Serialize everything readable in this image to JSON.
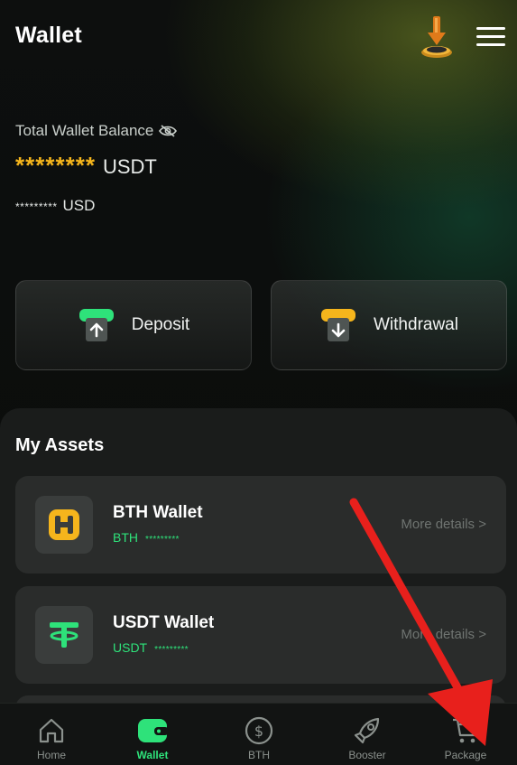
{
  "header": {
    "title": "Wallet",
    "download_icon": "download-icon",
    "menu_icon": "hamburger-menu-icon"
  },
  "balance": {
    "label": "Total Wallet Balance",
    "visibility_icon": "eye-slash-icon",
    "usdt_masked": "********",
    "usdt_unit": "USDT",
    "usd_masked": "*********",
    "usd_unit": "USD"
  },
  "actions": {
    "deposit_label": "Deposit",
    "withdrawal_label": "Withdrawal"
  },
  "assets": {
    "title": "My Assets",
    "items": [
      {
        "name": "BTH Wallet",
        "symbol": "BTH",
        "masked": "*********",
        "more": "More details >",
        "icon": "bth-logo-icon"
      },
      {
        "name": "USDT Wallet",
        "symbol": "USDT",
        "masked": "*********",
        "more": "More details >",
        "icon": "tether-logo-icon"
      }
    ]
  },
  "nav": {
    "items": [
      {
        "label": "Home",
        "icon": "home-icon"
      },
      {
        "label": "Wallet",
        "icon": "wallet-icon"
      },
      {
        "label": "BTH",
        "icon": "dollar-coin-icon"
      },
      {
        "label": "Booster",
        "icon": "rocket-icon"
      },
      {
        "label": "Package",
        "icon": "cart-icon"
      }
    ],
    "active": "Wallet"
  },
  "colors": {
    "accent_green": "#2ee27a",
    "accent_gold": "#f5b51c",
    "annotation_red": "#e8201c"
  }
}
